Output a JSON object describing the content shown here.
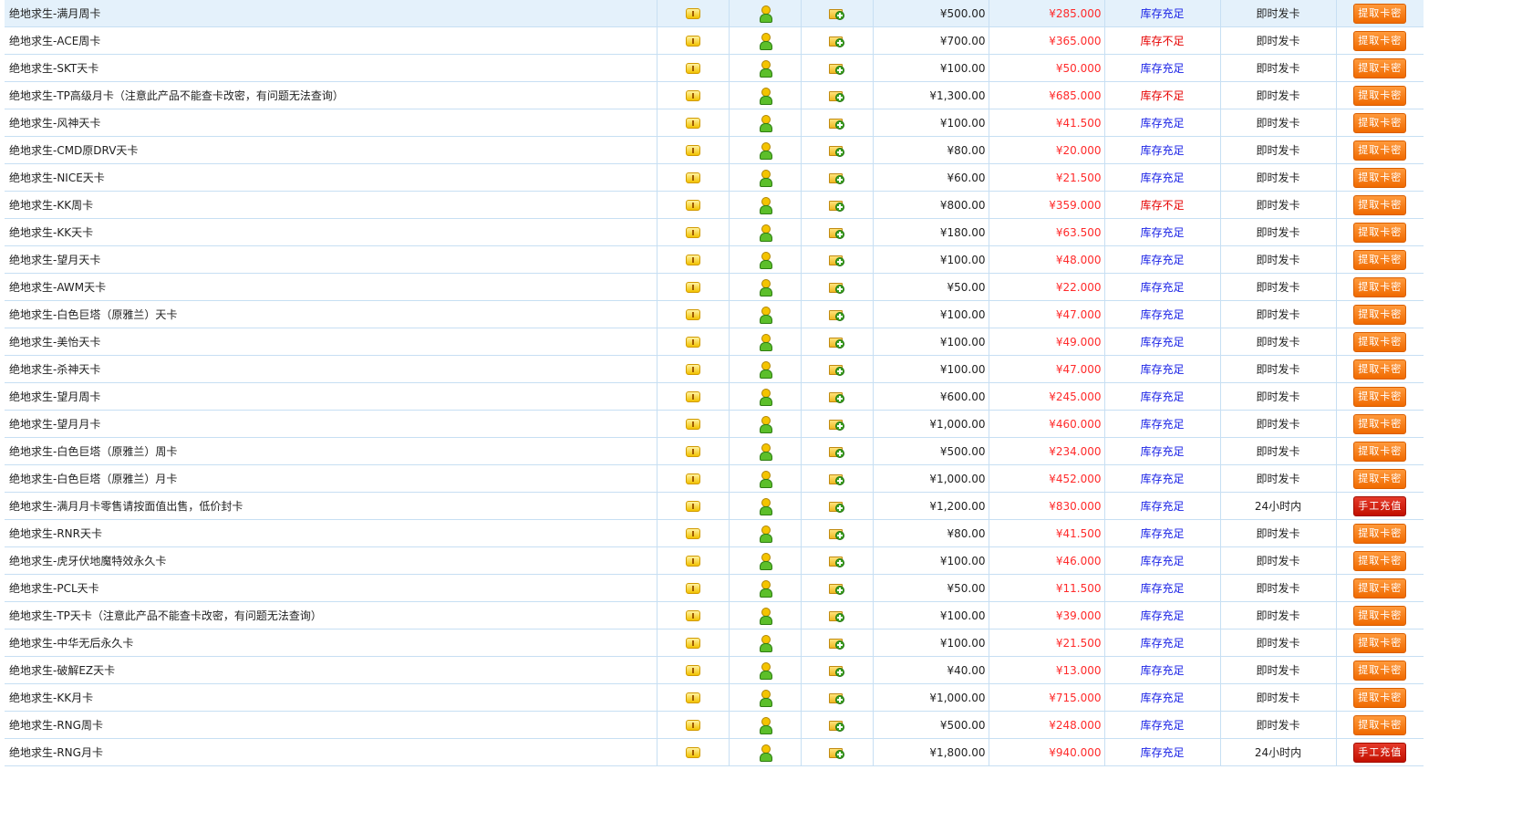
{
  "products": [
    {
      "name": "绝地求生-满月周卡",
      "price": "¥500.00",
      "discount": "¥285.000",
      "stock": "库存充足",
      "stock_ok": true,
      "ship": "即时发卡",
      "action": "提取卡密",
      "action_style": "orange",
      "highlight": true
    },
    {
      "name": "绝地求生-ACE周卡",
      "price": "¥700.00",
      "discount": "¥365.000",
      "stock": "库存不足",
      "stock_ok": false,
      "ship": "即时发卡",
      "action": "提取卡密",
      "action_style": "orange"
    },
    {
      "name": "绝地求生-SKT天卡",
      "price": "¥100.00",
      "discount": "¥50.000",
      "stock": "库存充足",
      "stock_ok": true,
      "ship": "即时发卡",
      "action": "提取卡密",
      "action_style": "orange"
    },
    {
      "name": "绝地求生-TP高级月卡（注意此产品不能查卡改密，有问题无法查询）",
      "price": "¥1,300.00",
      "discount": "¥685.000",
      "stock": "库存不足",
      "stock_ok": false,
      "ship": "即时发卡",
      "action": "提取卡密",
      "action_style": "orange"
    },
    {
      "name": "绝地求生-风神天卡",
      "price": "¥100.00",
      "discount": "¥41.500",
      "stock": "库存充足",
      "stock_ok": true,
      "ship": "即时发卡",
      "action": "提取卡密",
      "action_style": "orange"
    },
    {
      "name": "绝地求生-CMD原DRV天卡",
      "price": "¥80.00",
      "discount": "¥20.000",
      "stock": "库存充足",
      "stock_ok": true,
      "ship": "即时发卡",
      "action": "提取卡密",
      "action_style": "orange"
    },
    {
      "name": "绝地求生-NICE天卡",
      "price": "¥60.00",
      "discount": "¥21.500",
      "stock": "库存充足",
      "stock_ok": true,
      "ship": "即时发卡",
      "action": "提取卡密",
      "action_style": "orange"
    },
    {
      "name": "绝地求生-KK周卡",
      "price": "¥800.00",
      "discount": "¥359.000",
      "stock": "库存不足",
      "stock_ok": false,
      "ship": "即时发卡",
      "action": "提取卡密",
      "action_style": "orange"
    },
    {
      "name": "绝地求生-KK天卡",
      "price": "¥180.00",
      "discount": "¥63.500",
      "stock": "库存充足",
      "stock_ok": true,
      "ship": "即时发卡",
      "action": "提取卡密",
      "action_style": "orange"
    },
    {
      "name": "绝地求生-望月天卡",
      "price": "¥100.00",
      "discount": "¥48.000",
      "stock": "库存充足",
      "stock_ok": true,
      "ship": "即时发卡",
      "action": "提取卡密",
      "action_style": "orange"
    },
    {
      "name": "绝地求生-AWM天卡",
      "price": "¥50.00",
      "discount": "¥22.000",
      "stock": "库存充足",
      "stock_ok": true,
      "ship": "即时发卡",
      "action": "提取卡密",
      "action_style": "orange"
    },
    {
      "name": "绝地求生-白色巨塔（原雅兰）天卡",
      "price": "¥100.00",
      "discount": "¥47.000",
      "stock": "库存充足",
      "stock_ok": true,
      "ship": "即时发卡",
      "action": "提取卡密",
      "action_style": "orange"
    },
    {
      "name": "绝地求生-美怡天卡",
      "price": "¥100.00",
      "discount": "¥49.000",
      "stock": "库存充足",
      "stock_ok": true,
      "ship": "即时发卡",
      "action": "提取卡密",
      "action_style": "orange"
    },
    {
      "name": "绝地求生-杀神天卡",
      "price": "¥100.00",
      "discount": "¥47.000",
      "stock": "库存充足",
      "stock_ok": true,
      "ship": "即时发卡",
      "action": "提取卡密",
      "action_style": "orange"
    },
    {
      "name": "绝地求生-望月周卡",
      "price": "¥600.00",
      "discount": "¥245.000",
      "stock": "库存充足",
      "stock_ok": true,
      "ship": "即时发卡",
      "action": "提取卡密",
      "action_style": "orange"
    },
    {
      "name": "绝地求生-望月月卡",
      "price": "¥1,000.00",
      "discount": "¥460.000",
      "stock": "库存充足",
      "stock_ok": true,
      "ship": "即时发卡",
      "action": "提取卡密",
      "action_style": "orange"
    },
    {
      "name": "绝地求生-白色巨塔（原雅兰）周卡",
      "price": "¥500.00",
      "discount": "¥234.000",
      "stock": "库存充足",
      "stock_ok": true,
      "ship": "即时发卡",
      "action": "提取卡密",
      "action_style": "orange"
    },
    {
      "name": "绝地求生-白色巨塔（原雅兰）月卡",
      "price": "¥1,000.00",
      "discount": "¥452.000",
      "stock": "库存充足",
      "stock_ok": true,
      "ship": "即时发卡",
      "action": "提取卡密",
      "action_style": "orange"
    },
    {
      "name": "绝地求生-满月月卡零售请按面值出售，低价封卡",
      "price": "¥1,200.00",
      "discount": "¥830.000",
      "stock": "库存充足",
      "stock_ok": true,
      "ship": "24小时内",
      "action": "手工充值",
      "action_style": "red"
    },
    {
      "name": "绝地求生-RNR天卡",
      "price": "¥80.00",
      "discount": "¥41.500",
      "stock": "库存充足",
      "stock_ok": true,
      "ship": "即时发卡",
      "action": "提取卡密",
      "action_style": "orange"
    },
    {
      "name": "绝地求生-虎牙伏地魔特效永久卡",
      "price": "¥100.00",
      "discount": "¥46.000",
      "stock": "库存充足",
      "stock_ok": true,
      "ship": "即时发卡",
      "action": "提取卡密",
      "action_style": "orange"
    },
    {
      "name": "绝地求生-PCL天卡",
      "price": "¥50.00",
      "discount": "¥11.500",
      "stock": "库存充足",
      "stock_ok": true,
      "ship": "即时发卡",
      "action": "提取卡密",
      "action_style": "orange"
    },
    {
      "name": "绝地求生-TP天卡（注意此产品不能查卡改密，有问题无法查询）",
      "price": "¥100.00",
      "discount": "¥39.000",
      "stock": "库存充足",
      "stock_ok": true,
      "ship": "即时发卡",
      "action": "提取卡密",
      "action_style": "orange"
    },
    {
      "name": "绝地求生-中华无后永久卡",
      "price": "¥100.00",
      "discount": "¥21.500",
      "stock": "库存充足",
      "stock_ok": true,
      "ship": "即时发卡",
      "action": "提取卡密",
      "action_style": "orange"
    },
    {
      "name": "绝地求生-破解EZ天卡",
      "price": "¥40.00",
      "discount": "¥13.000",
      "stock": "库存充足",
      "stock_ok": true,
      "ship": "即时发卡",
      "action": "提取卡密",
      "action_style": "orange"
    },
    {
      "name": "绝地求生-KK月卡",
      "price": "¥1,000.00",
      "discount": "¥715.000",
      "stock": "库存充足",
      "stock_ok": true,
      "ship": "即时发卡",
      "action": "提取卡密",
      "action_style": "orange"
    },
    {
      "name": "绝地求生-RNG周卡",
      "price": "¥500.00",
      "discount": "¥248.000",
      "stock": "库存充足",
      "stock_ok": true,
      "ship": "即时发卡",
      "action": "提取卡密",
      "action_style": "orange"
    },
    {
      "name": "绝地求生-RNG月卡",
      "price": "¥1,800.00",
      "discount": "¥940.000",
      "stock": "库存充足",
      "stock_ok": true,
      "ship": "24小时内",
      "action": "手工充值",
      "action_style": "red"
    }
  ],
  "icons": {
    "notice": "warning-icon",
    "agent": "user-icon",
    "favorite": "folder-add-icon"
  },
  "colors": {
    "stock_ok": "#1a22e6",
    "stock_low": "#e60000",
    "discount": "#ff2a2a",
    "button_orange": "#f06a00",
    "button_red": "#c21000",
    "row_highlight": "#e4f1fb"
  }
}
